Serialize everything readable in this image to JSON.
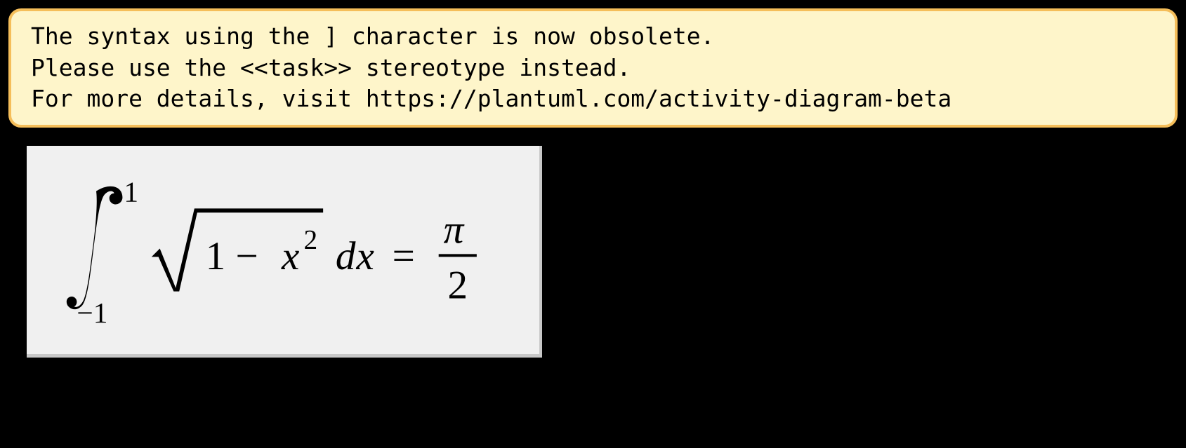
{
  "warning": {
    "line1": "The syntax using the ] character is now obsolete.",
    "line2": "Please use the <<task>> stereotype instead.",
    "line3": "For more details, visit https://plantuml.com/activity-diagram-beta"
  },
  "math": {
    "latex": "\\int_{-1}^{1} \\sqrt{1 - x^2}\\, dx = \\frac{\\pi}{2}",
    "integral_lower": "−1",
    "integral_upper": "1",
    "radicand_pre": "1 − ",
    "radicand_var": "x",
    "radicand_exp": "2",
    "differential_d": "d",
    "differential_var": "x",
    "equals": "=",
    "fraction_num": "π",
    "fraction_den": "2"
  }
}
